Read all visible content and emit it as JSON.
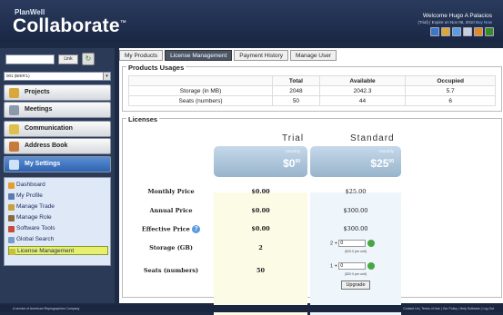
{
  "header": {
    "brand_top": "PlanWell",
    "brand": "Collaborate",
    "tm": "™",
    "welcome": "Welcome Hugo A Palacios",
    "trial_text": "(Trial) | Expire on Nov 06, 2010",
    "buy_now": "Buy Now"
  },
  "sidebar": {
    "search_button": "Link",
    "select_value": "001 (BIER'L)",
    "nav": [
      {
        "label": "Projects"
      },
      {
        "label": "Meetings"
      },
      {
        "label": "Communication"
      },
      {
        "label": "Address Book"
      },
      {
        "label": "My Settings"
      }
    ],
    "submenu": [
      {
        "label": "Dashboard"
      },
      {
        "label": "My Profile"
      },
      {
        "label": "Manage Trade"
      },
      {
        "label": "Manage Role"
      },
      {
        "label": "Software Tools"
      },
      {
        "label": "Global Search"
      },
      {
        "label": "License Management"
      }
    ]
  },
  "tabs": [
    {
      "label": "My Products"
    },
    {
      "label": "License Management"
    },
    {
      "label": "Payment History"
    },
    {
      "label": "Manage User"
    }
  ],
  "usages": {
    "title": "Products Usages",
    "headers": [
      "",
      "Total",
      "Available",
      "Occupied"
    ],
    "rows": [
      [
        "Storage (in MB)",
        "2048",
        "2042.3",
        "5.7"
      ],
      [
        "Seats (numbers)",
        "50",
        "44",
        "6"
      ]
    ]
  },
  "licenses": {
    "title": "Licenses",
    "plans": [
      {
        "name": "Trial",
        "sub": "Monthly",
        "price": "$0",
        "cents": "00"
      },
      {
        "name": "Standard",
        "sub": "Monthly",
        "price": "$25",
        "cents": "00"
      }
    ],
    "rows": [
      {
        "label": "Monthly Price",
        "trial": "$0.00",
        "standard": "$25.00"
      },
      {
        "label": "Annual Price",
        "trial": "$0.00",
        "standard": "$300.00"
      },
      {
        "label": "Effective Price",
        "trial": "$0.00",
        "standard": "$300.00"
      },
      {
        "label": "Storage (GB)",
        "trial": "2",
        "standard_prefix": "2 +",
        "standard_value": "0",
        "standard_unit": "($10.0 per unit)"
      },
      {
        "label": "Seats (numbers)",
        "trial": "50",
        "standard_prefix": "1 +",
        "standard_value": "0",
        "standard_unit": "($20.0 per unit)"
      }
    ],
    "help_icon": "?",
    "upgrade_label": "Upgrade"
  },
  "footer": {
    "left": "A service of American Reprographics Company",
    "right": "Contact Us | Terms of Use | Our Policy | Help Software | Log Out"
  },
  "colors": {
    "header": "#1a2744",
    "active_tab": "#4a5566",
    "active_sub": "#e6ef6f"
  }
}
